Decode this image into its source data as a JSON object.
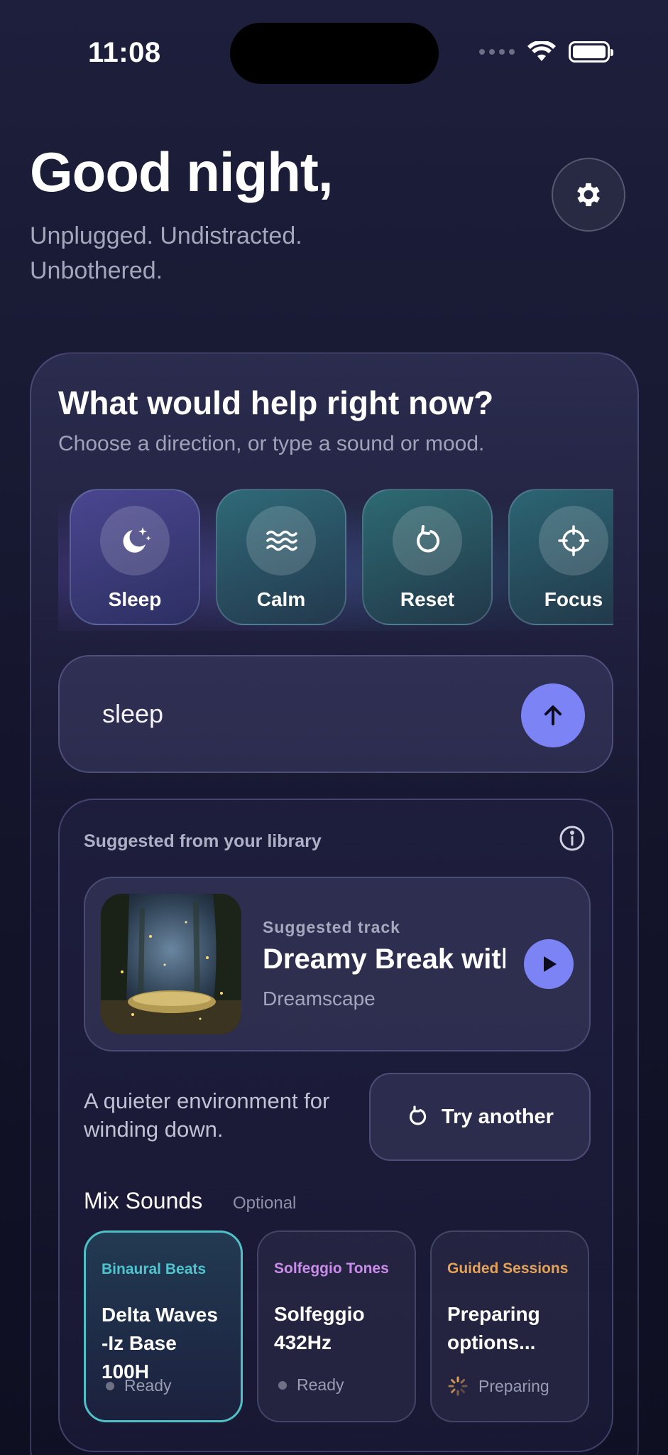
{
  "status_bar": {
    "time": "11:08"
  },
  "header": {
    "greeting": "Good night,",
    "subtitle": "Unplugged. Undistracted. Unbothered."
  },
  "prompt_card": {
    "title": "What would help right now?",
    "subtitle": "Choose a direction, or type a sound or mood.",
    "moods": [
      {
        "label": "Sleep",
        "icon": "moon-stars-icon"
      },
      {
        "label": "Calm",
        "icon": "waves-icon"
      },
      {
        "label": "Reset",
        "icon": "rotate-icon"
      },
      {
        "label": "Focus",
        "icon": "crosshair-icon"
      }
    ],
    "search": {
      "value": "sleep"
    }
  },
  "suggestion": {
    "title": "Suggested from your library",
    "track": {
      "kicker": "Suggested track",
      "name": "Dreamy Break with",
      "artist": "Dreamscape"
    },
    "description": "A quieter environment for winding down.",
    "try_another_label": "Try another",
    "mix": {
      "title": "Mix Sounds",
      "optional_label": "Optional",
      "cards": [
        {
          "category": "Binaural Beats",
          "category_color": "#4fc6cf",
          "name": "Delta Waves\n-Iz Base 100H",
          "status": "Ready"
        },
        {
          "category": "Solfeggio Tones",
          "category_color": "#c98ce8",
          "name": "Solfeggio\n432Hz",
          "status": "Ready"
        },
        {
          "category": "Guided Sessions",
          "category_color": "#e4a256",
          "name": "Preparing\noptions...",
          "status": "Preparing"
        }
      ]
    }
  },
  "colors": {
    "accent": "#7b83f5",
    "active_border": "#4fc0c6"
  }
}
